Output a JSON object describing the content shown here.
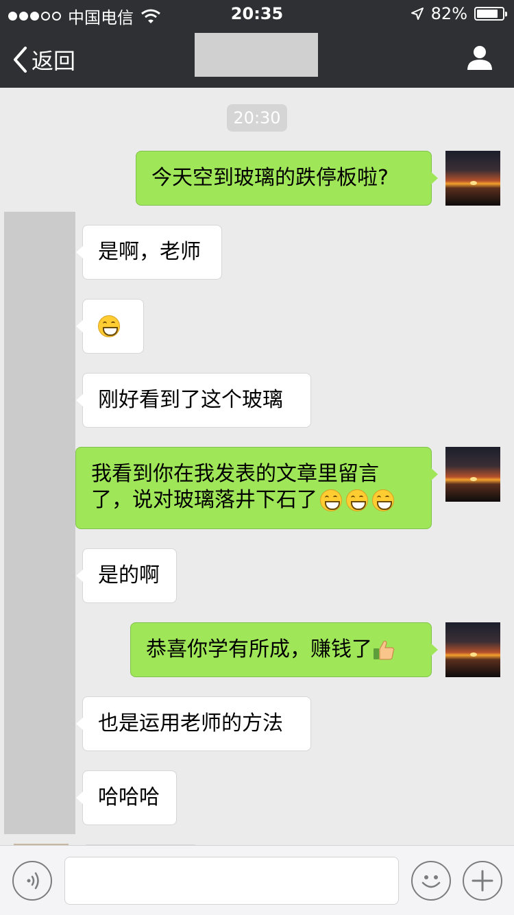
{
  "status_bar": {
    "carrier": "中国电信",
    "time": "20:35",
    "battery_text": "82%",
    "battery_level": 0.82,
    "signal_bars_filled": 3,
    "signal_bars_total": 5
  },
  "nav": {
    "back_label": "返回"
  },
  "chat": {
    "timestamp": "20:30",
    "messages": [
      {
        "side": "out",
        "text": "今天空到玻璃的跌停板啦?"
      },
      {
        "side": "in",
        "text": "是啊，老师"
      },
      {
        "side": "in",
        "text": "",
        "emoji": "grin-emoji"
      },
      {
        "side": "in",
        "text": "刚好看到了这个玻璃"
      },
      {
        "side": "out",
        "line1": "我看到你在我发表的文章里留言",
        "line2": "了，说对玻璃落井下石了",
        "emoji": "grin-emoji",
        "emoji_count": 3
      },
      {
        "side": "in",
        "text": "是的啊"
      },
      {
        "side": "out",
        "text": "恭喜你学有所成，赚钱了",
        "emoji": "thumbs-up-emoji"
      },
      {
        "side": "in",
        "text": "也是运用老师的方法"
      },
      {
        "side": "in",
        "text": "哈哈哈"
      }
    ]
  },
  "colors": {
    "nav_bg": "#2e3033",
    "chat_bg": "#ebebeb",
    "outgoing_bubble": "#9fe658",
    "incoming_bubble": "#ffffff"
  }
}
